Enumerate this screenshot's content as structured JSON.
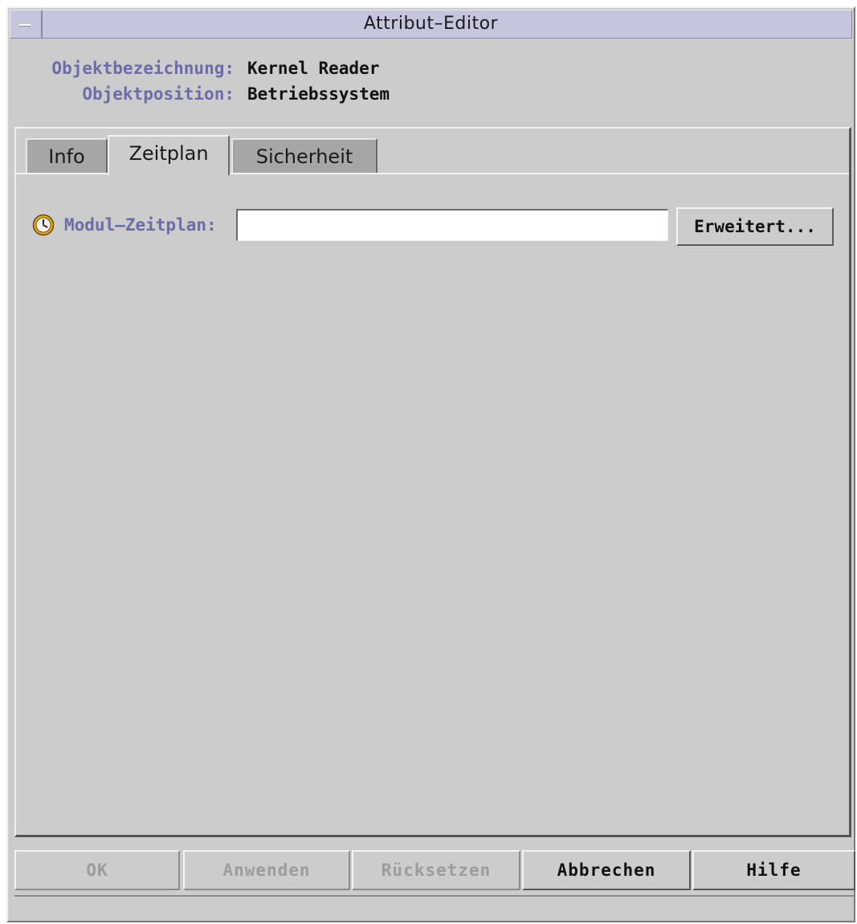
{
  "window": {
    "title": "Attribut–Editor"
  },
  "object": {
    "name_label": "Objektbezeichnung:",
    "name_value": "Kernel Reader",
    "position_label": "Objektposition:",
    "position_value": "Betriebssystem"
  },
  "tabs": [
    {
      "label": "Info",
      "active": false
    },
    {
      "label": "Zeitplan",
      "active": true
    },
    {
      "label": "Sicherheit",
      "active": false
    }
  ],
  "schedule": {
    "icon": "clock-icon",
    "label": "Modul–Zeitplan:",
    "value": "",
    "advanced_button": "Erweitert..."
  },
  "footer_buttons": [
    {
      "label": "OK",
      "enabled": false
    },
    {
      "label": "Anwenden",
      "enabled": false
    },
    {
      "label": "Rücksetzen",
      "enabled": false
    },
    {
      "label": "Abbrechen",
      "enabled": true
    },
    {
      "label": "Hilfe",
      "enabled": true
    }
  ],
  "colors": {
    "window_background": "#cccccc",
    "titlebar": "#c5c5dd",
    "label_accent": "#6c6ca8",
    "disabled_text": "#9c9c9c"
  }
}
